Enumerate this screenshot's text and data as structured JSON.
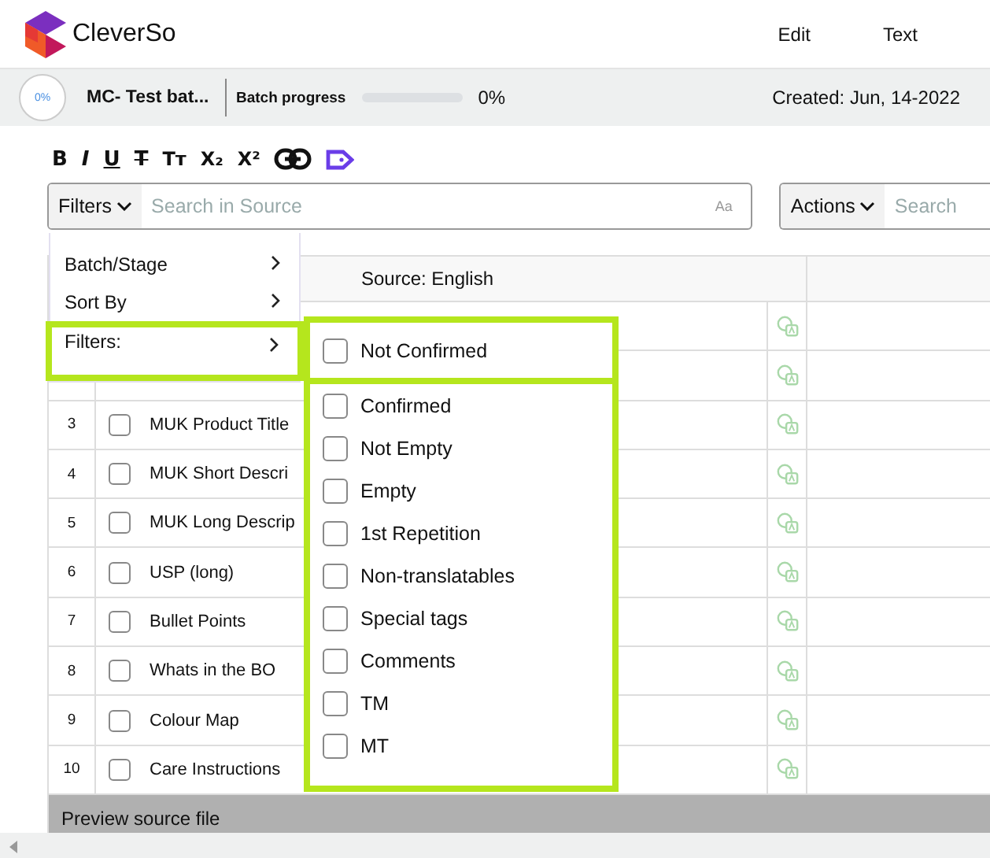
{
  "header": {
    "logo_text": "CleverSo",
    "nav": [
      "Edit",
      "Text"
    ]
  },
  "batch": {
    "progress_badge": "0%",
    "name": "MC- Test bat...",
    "progress_label": "Batch progress",
    "level": 0,
    "progress_value": "0%",
    "created": "Created: Jun, 14-2022"
  },
  "toolbar": [
    {
      "kind": "bold",
      "label": "B"
    },
    {
      "kind": "italic",
      "label": "I"
    },
    {
      "kind": "underline",
      "label": "U"
    },
    {
      "kind": "strike",
      "label": "T"
    },
    {
      "kind": "case",
      "label": "Tт"
    },
    {
      "kind": "sub",
      "label": "X₂"
    },
    {
      "kind": "super",
      "label": "X²"
    },
    {
      "kind": "link"
    },
    {
      "kind": "tag"
    }
  ],
  "search": {
    "filter_button": "Filters",
    "placeholder": "Search in Source",
    "match_case": "Aa"
  },
  "actions": {
    "button": "Actions",
    "placeholder": "Search"
  },
  "table": {
    "source_header": "Source: English",
    "rows": [
      {},
      {},
      {
        "number": "3",
        "label": "MUK Product Title",
        "checked": false
      },
      {
        "number": "4",
        "label": "MUK Short Descri",
        "checked": false
      },
      {
        "number": "5",
        "label": "MUK Long Descrip",
        "checked": false
      },
      {
        "number": "6",
        "label": "USP (long)",
        "checked": false
      },
      {
        "number": "7",
        "label": "Bullet Points",
        "checked": false
      },
      {
        "number": "8",
        "label": "Whats in the BO",
        "checked": false
      },
      {
        "number": "9",
        "label": "Colour Map",
        "checked": false
      },
      {
        "number": "10",
        "label": "Care Instructions",
        "checked": false
      }
    ]
  },
  "footer": "Preview source file",
  "menu": {
    "items": [
      {
        "label": "Batch/Stage",
        "highlighted": false
      },
      {
        "label": "Sort By",
        "highlighted": false
      },
      {
        "label": "Filters:",
        "highlighted": true
      }
    ],
    "filter_groups": [
      {
        "highlighted": true,
        "options": [
          {
            "label": "Not Confirmed",
            "checked": false
          }
        ]
      },
      {
        "highlighted": true,
        "options": [
          {
            "label": "Confirmed",
            "checked": false
          },
          {
            "label": "Not Empty",
            "checked": false
          },
          {
            "label": "Empty",
            "checked": false
          },
          {
            "label": "1st Repetition",
            "checked": false
          },
          {
            "label": "Non-translatables",
            "checked": false
          },
          {
            "label": "Special tags",
            "checked": false
          },
          {
            "label": "Comments",
            "checked": false
          },
          {
            "label": "TM",
            "checked": false
          },
          {
            "label": "MT",
            "checked": false
          }
        ]
      }
    ]
  }
}
